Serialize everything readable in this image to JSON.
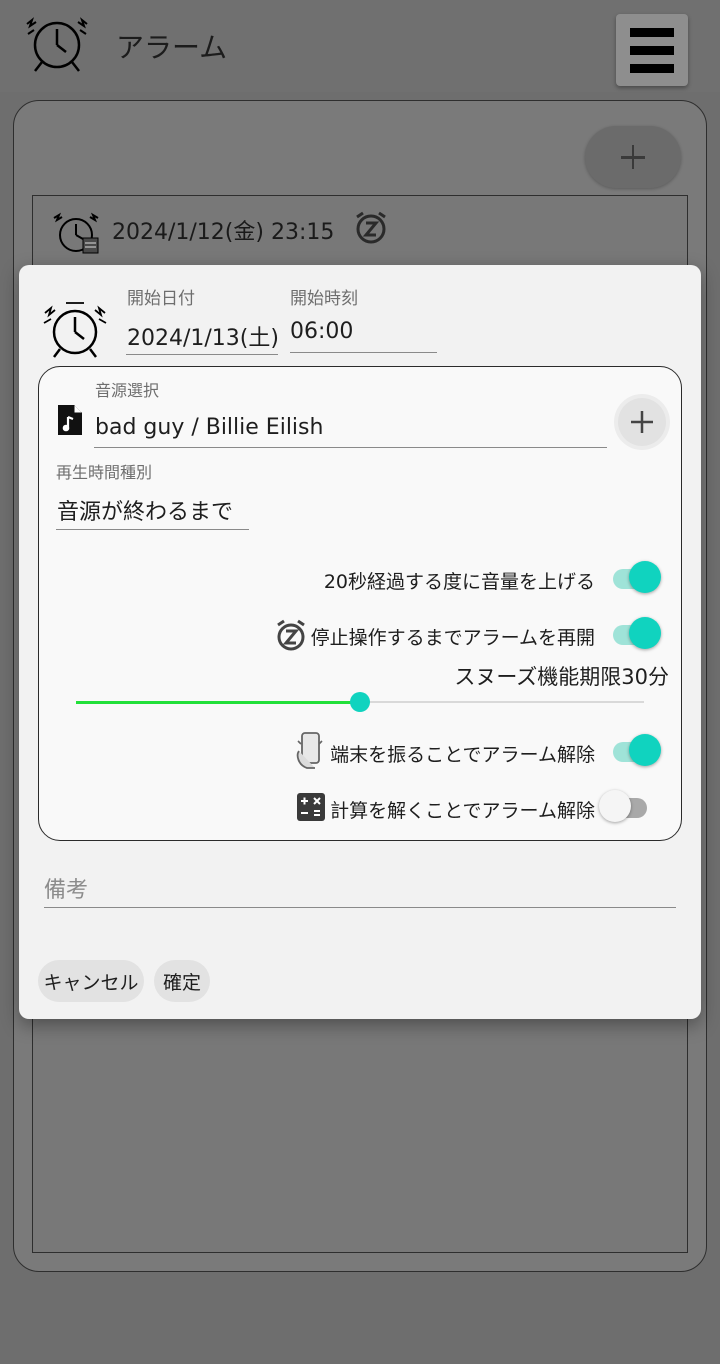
{
  "app": {
    "title": "アラーム",
    "alarm_list": [
      {
        "datetime": "2024/1/12(金) 23:15",
        "snooze": true
      }
    ]
  },
  "dialog": {
    "start_date": {
      "label": "開始日付",
      "value": "2024/1/13(土)"
    },
    "start_time": {
      "label": "開始時刻",
      "value": "06:00"
    },
    "sound": {
      "label": "音源選択",
      "value": "bad guy / Billie Eilish"
    },
    "play_duration": {
      "label": "再生時間種別",
      "value": "音源が終わるまで"
    },
    "volume_up": {
      "label": "20秒経過する度に音量を上げる",
      "on": true
    },
    "snooze_restart": {
      "label": "停止操作するまでアラームを再開",
      "on": true
    },
    "snooze_limit": {
      "label": "スヌーズ機能期限30分",
      "value_fraction": 0.5
    },
    "shake_dismiss": {
      "label": "端末を振ることでアラーム解除",
      "on": true
    },
    "math_dismiss": {
      "label": "計算を解くことでアラーム解除",
      "on": false
    },
    "memo": {
      "placeholder": "備考"
    },
    "cancel_label": "キャンセル",
    "confirm_label": "確定"
  },
  "colors": {
    "toggle_on": "#10d3bf",
    "slider_active": "#22e03a",
    "slider_thumb": "#10d3bf"
  },
  "icons": [
    "alarm-clock-icon",
    "menu-icon",
    "plus-icon",
    "snooze-icon",
    "music-file-icon",
    "shake-phone-icon",
    "calculator-icon"
  ]
}
